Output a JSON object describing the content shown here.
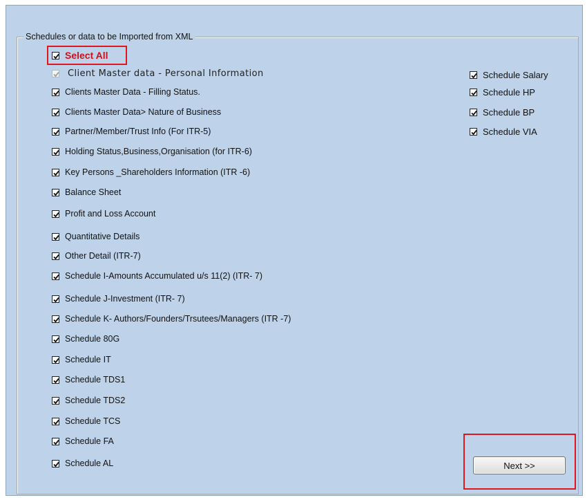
{
  "groupbox": {
    "title": "Schedules or data to be Imported from XML"
  },
  "select_all": {
    "label": "Select All",
    "checked": true
  },
  "left_items": [
    {
      "label": "Client Master data - Personal Information",
      "checked": true,
      "disabled": true
    },
    {
      "label": "Clients Master Data -  Filling Status.",
      "checked": true
    },
    {
      "label": "Clients Master Data> Nature of Business",
      "checked": true
    },
    {
      "label": "Partner/Member/Trust Info (For ITR-5)",
      "checked": true
    },
    {
      "label": "Holding Status,Business,Organisation (for ITR-6)",
      "checked": true
    },
    {
      "label": "Key Persons _Shareholders Information (ITR -6)",
      "checked": true
    },
    {
      "label": "Balance Sheet",
      "checked": true
    },
    {
      "label": "Profit and Loss Account",
      "checked": true
    },
    {
      "label": "Quantitative Details",
      "checked": true
    },
    {
      "label": "Other Detail  (ITR-7)",
      "checked": true
    },
    {
      "label": "Schedule I-Amounts Accumulated u/s 11(2) (ITR- 7)",
      "checked": true
    },
    {
      "label": "Schedule J-Investment (ITR- 7)",
      "checked": true
    },
    {
      "label": "Schedule K- Authors/Founders/Trsutees/Managers (ITR -7)",
      "checked": true
    },
    {
      "label": "Schedule 80G",
      "checked": true
    },
    {
      "label": "Schedule IT",
      "checked": true
    },
    {
      "label": "Schedule TDS1",
      "checked": true
    },
    {
      "label": "Schedule TDS2",
      "checked": true
    },
    {
      "label": "Schedule TCS",
      "checked": true
    },
    {
      "label": "Schedule FA",
      "checked": true
    },
    {
      "label": "Schedule AL",
      "checked": true
    }
  ],
  "right_items": [
    {
      "label": "Schedule Salary",
      "checked": true
    },
    {
      "label": "Schedule HP",
      "checked": true
    },
    {
      "label": "Schedule BP",
      "checked": true
    },
    {
      "label": "Schedule VIA",
      "checked": true
    }
  ],
  "next_button": {
    "label": "Next >>"
  },
  "colors": {
    "panel": "#bed3ea",
    "highlight": "#e0161f",
    "select_all_text": "#d0101b"
  }
}
